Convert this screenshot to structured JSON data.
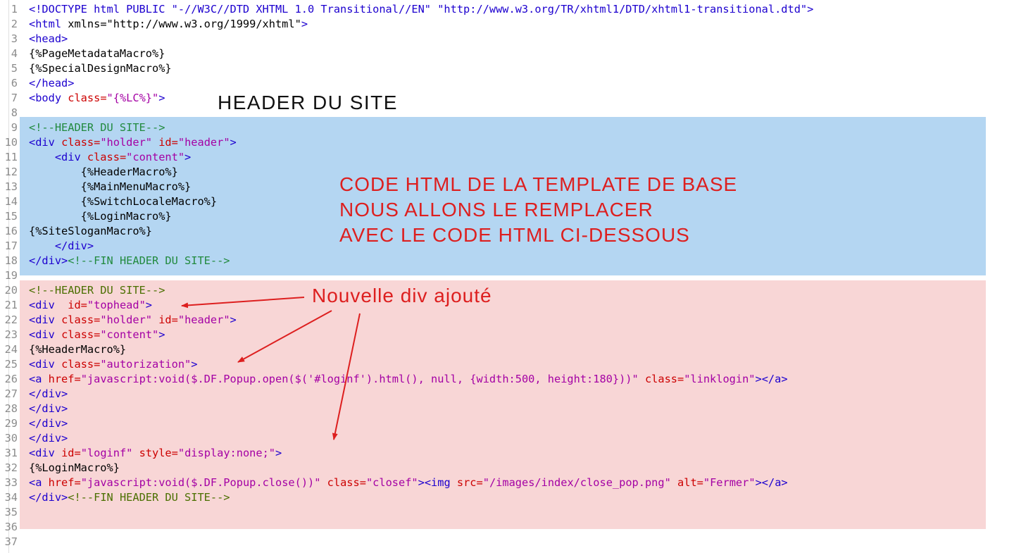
{
  "editor": {
    "colors": {
      "tag": "#1c00cf",
      "attribute": "#cc0000",
      "value": "#a400a4",
      "comment": "#218a3e",
      "highlight_blue": "#b4d6f2",
      "highlight_pink": "#f8d6d6",
      "annotation": "#dd1f1f"
    },
    "lines": [
      {
        "n": "1",
        "segs": [
          [
            "t",
            "<!DOCTYPE html PUBLIC \"-//W3C//DTD XHTML 1.0 Transitional//EN\" \"http://www.w3.org/TR/xhtml1/DTD/xhtml1-transitional.dtd\">"
          ]
        ]
      },
      {
        "n": "2",
        "segs": [
          [
            "t",
            "<html "
          ],
          [
            "p",
            "xmlns=\"http://www.w3.org/1999/xhtml\""
          ],
          [
            "t",
            ">"
          ]
        ]
      },
      {
        "n": "3",
        "segs": [
          [
            "t",
            "<head>"
          ]
        ]
      },
      {
        "n": "4",
        "segs": [
          [
            "p",
            "{%PageMetadataMacro%}"
          ]
        ]
      },
      {
        "n": "5",
        "segs": [
          [
            "p",
            "{%SpecialDesignMacro%}"
          ]
        ]
      },
      {
        "n": "6",
        "segs": [
          [
            "t",
            "</head>"
          ]
        ]
      },
      {
        "n": "7",
        "segs": [
          [
            "t",
            "<body "
          ],
          [
            "a",
            "class="
          ],
          [
            "v",
            "\"{%LC%}\""
          ],
          [
            "t",
            ">"
          ]
        ]
      },
      {
        "n": "8",
        "segs": []
      },
      {
        "n": "9",
        "segs": [
          [
            "c",
            "<!--HEADER DU SITE-->"
          ]
        ]
      },
      {
        "n": "10",
        "segs": [
          [
            "t",
            "<div "
          ],
          [
            "a",
            "class="
          ],
          [
            "v",
            "\"holder\" "
          ],
          [
            "a",
            "id="
          ],
          [
            "v",
            "\"header\""
          ],
          [
            "t",
            ">"
          ]
        ]
      },
      {
        "n": "11",
        "segs": [
          [
            "t",
            "    <div "
          ],
          [
            "a",
            "class="
          ],
          [
            "v",
            "\"content\""
          ],
          [
            "t",
            ">"
          ]
        ]
      },
      {
        "n": "12",
        "segs": [
          [
            "p",
            "        {%HeaderMacro%}"
          ]
        ]
      },
      {
        "n": "13",
        "segs": [
          [
            "p",
            "        {%MainMenuMacro%}"
          ]
        ]
      },
      {
        "n": "14",
        "segs": [
          [
            "p",
            "        {%SwitchLocaleMacro%}"
          ]
        ]
      },
      {
        "n": "15",
        "segs": [
          [
            "p",
            "        {%LoginMacro%}"
          ]
        ]
      },
      {
        "n": "16",
        "segs": [
          [
            "p",
            "{%SiteSloganMacro%}"
          ]
        ]
      },
      {
        "n": "17",
        "segs": [
          [
            "t",
            "    </div>"
          ]
        ]
      },
      {
        "n": "18",
        "segs": [
          [
            "t",
            "</div>"
          ],
          [
            "c",
            "<!--FIN HEADER DU SITE-->"
          ]
        ]
      },
      {
        "n": "19",
        "segs": []
      },
      {
        "n": "20",
        "segs": [
          [
            "c2",
            "<!--HEADER DU SITE-->"
          ]
        ]
      },
      {
        "n": "21",
        "segs": [
          [
            "t",
            "<div  "
          ],
          [
            "a",
            "id="
          ],
          [
            "v",
            "\"tophead\""
          ],
          [
            "t",
            ">"
          ]
        ]
      },
      {
        "n": "22",
        "segs": [
          [
            "t",
            "<div "
          ],
          [
            "a",
            "class="
          ],
          [
            "v",
            "\"holder\" "
          ],
          [
            "a",
            "id="
          ],
          [
            "v",
            "\"header\""
          ],
          [
            "t",
            ">"
          ]
        ]
      },
      {
        "n": "23",
        "segs": [
          [
            "t",
            "<div "
          ],
          [
            "a",
            "class="
          ],
          [
            "v",
            "\"content\""
          ],
          [
            "t",
            ">"
          ]
        ]
      },
      {
        "n": "24",
        "segs": [
          [
            "p",
            "{%HeaderMacro%}"
          ]
        ]
      },
      {
        "n": "25",
        "segs": [
          [
            "t",
            "<div "
          ],
          [
            "a",
            "class="
          ],
          [
            "v",
            "\"autorization\""
          ],
          [
            "t",
            ">"
          ]
        ]
      },
      {
        "n": "26",
        "segs": [
          [
            "t",
            "<a "
          ],
          [
            "a",
            "href="
          ],
          [
            "v",
            "\"javascript:void($.DF.Popup.open($('#loginf').html(), null, {width:500, height:180}))\" "
          ],
          [
            "a",
            "class="
          ],
          [
            "v",
            "\"linklogin\""
          ],
          [
            "t",
            "></a>"
          ]
        ]
      },
      {
        "n": "27",
        "segs": [
          [
            "t",
            "</div>"
          ]
        ]
      },
      {
        "n": "28",
        "segs": [
          [
            "t",
            "</div>"
          ]
        ]
      },
      {
        "n": "29",
        "segs": [
          [
            "t",
            "</div>"
          ]
        ]
      },
      {
        "n": "30",
        "segs": [
          [
            "t",
            "</div>"
          ]
        ]
      },
      {
        "n": "31",
        "segs": [
          [
            "t",
            "<div "
          ],
          [
            "a",
            "id="
          ],
          [
            "v",
            "\"loginf\" "
          ],
          [
            "a",
            "style="
          ],
          [
            "v",
            "\"display:none;\""
          ],
          [
            "t",
            ">"
          ]
        ]
      },
      {
        "n": "32",
        "segs": [
          [
            "p",
            "{%LoginMacro%}"
          ]
        ]
      },
      {
        "n": "33",
        "segs": [
          [
            "t",
            "<a "
          ],
          [
            "a",
            "href="
          ],
          [
            "v",
            "\"javascript:void($.DF.Popup.close())\" "
          ],
          [
            "a",
            "class="
          ],
          [
            "v",
            "\"closef\""
          ],
          [
            "t",
            "><img "
          ],
          [
            "a",
            "src="
          ],
          [
            "v",
            "\"/images/index/close_pop.png\" "
          ],
          [
            "a",
            "alt="
          ],
          [
            "v",
            "\"Fermer\""
          ],
          [
            "t",
            "></a>"
          ]
        ]
      },
      {
        "n": "34",
        "segs": [
          [
            "t",
            "</div>"
          ],
          [
            "c2",
            "<!--FIN HEADER DU SITE-->"
          ]
        ]
      },
      {
        "n": "35",
        "segs": []
      },
      {
        "n": "36",
        "segs": []
      },
      {
        "n": "37",
        "segs": []
      }
    ]
  },
  "annotations": {
    "header_title": "HEADER DU SITE",
    "base_code_note": [
      "CODE HTML DE LA TEMPLATE DE BASE",
      "NOUS ALLONS LE REMPLACER",
      "AVEC LE CODE HTML CI-DESSOUS"
    ],
    "new_div_note": "Nouvelle div ajouté"
  }
}
